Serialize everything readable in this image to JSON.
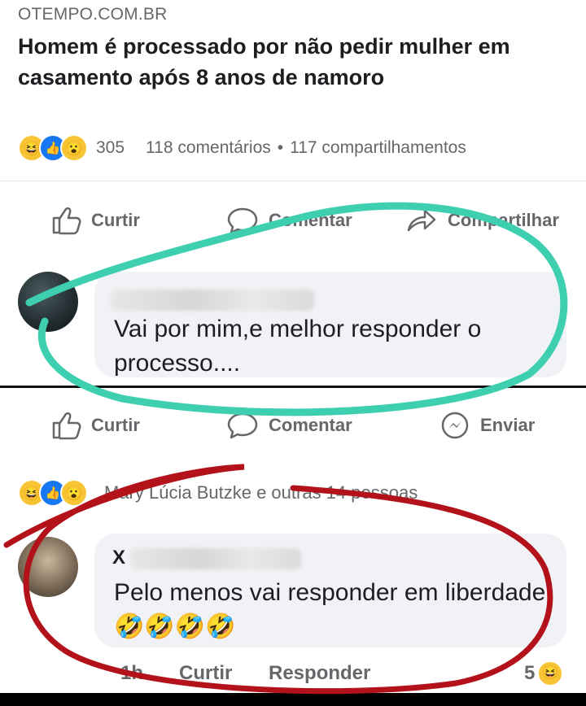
{
  "post": {
    "site": "OTEMPO.COM.BR",
    "headline": "Homem é processado por não pedir mulher em casamento após 8 anos de namoro",
    "reaction_count": "305",
    "comments_count": "118 comentários",
    "separator": "•",
    "shares_count": "117 compartilhamentos"
  },
  "post_actions": {
    "like": "Curtir",
    "comment": "Comentar",
    "share": "Compartilhar"
  },
  "comment1": {
    "text": "Vai por mim,e melhor responder o processo...."
  },
  "comment1_actions": {
    "like": "Curtir",
    "comment": "Comentar",
    "send": "Enviar"
  },
  "comment2": {
    "reactors": "Mary Lúcia Butzke e outras 14 pessoas",
    "name_initial": "X",
    "text": "Pelo menos vai responder em liberdade! 🤣🤣🤣🤣",
    "time": "1h",
    "like": "Curtir",
    "reply": "Responder",
    "reaction_count": "5"
  },
  "colors": {
    "teal_mark": "#3ecfb0",
    "red_mark": "#b3121a",
    "fb_blue": "#1877f2",
    "bubble_bg": "#f0f2f5",
    "secondary_text": "#65676b"
  },
  "icons": [
    "haha-icon",
    "like-icon",
    "wow-icon",
    "thumbs-up-icon",
    "comment-icon",
    "share-icon",
    "messenger-icon"
  ]
}
